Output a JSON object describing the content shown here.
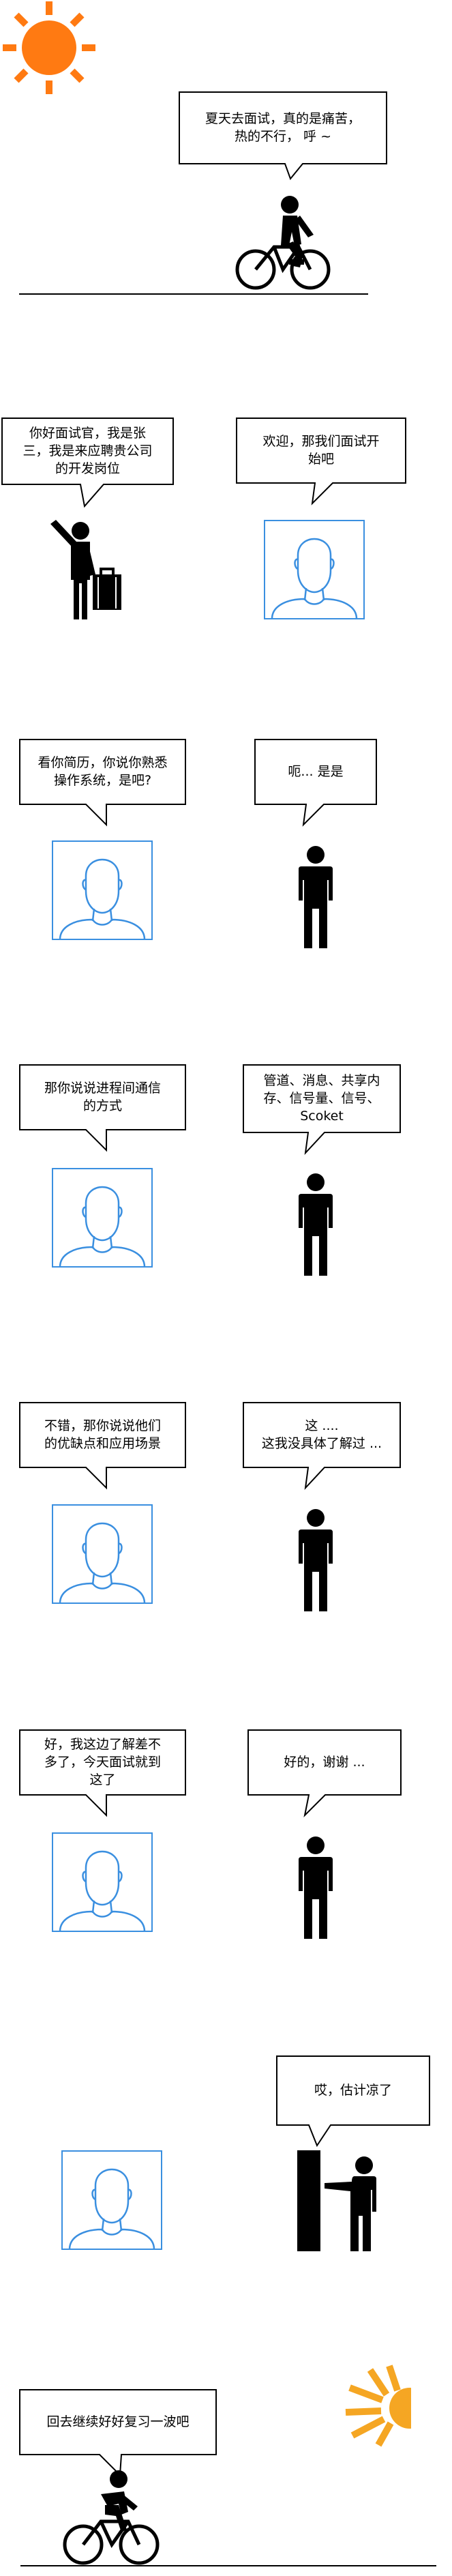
{
  "scenes": [
    {
      "caption": "夏天去面试，真的是痛苦，\n热的不行， 呼 ~"
    },
    {
      "left": "你好面试官，我是张\n三，我是来应聘贵公司\n的开发岗位",
      "right": "欢迎，那我们面试开\n始吧"
    },
    {
      "left": "看你简历，你说你熟悉\n操作系统，是吧?",
      "right": "呃... 是是"
    },
    {
      "left": "那你说说进程间通信\n的方式",
      "right": "管道、消息、共享内\n存、信号量、信号、\nScoket"
    },
    {
      "left": "不错，那你说说他们\n的优缺点和应用场景",
      "right": "这 ....\n这我没具体了解过 ..."
    },
    {
      "left": "好，我这边了解差不\n多了，今天面试就到\n这了",
      "right": "好的，谢谢 ..."
    },
    {
      "right": "哎，估计凉了"
    },
    {
      "left": "回去继续好好复习一波吧"
    }
  ],
  "colors": {
    "sun": "#ff7a12",
    "sun_end": "#f5a623",
    "portrait": "#3a8fe0",
    "ink": "#000000"
  }
}
